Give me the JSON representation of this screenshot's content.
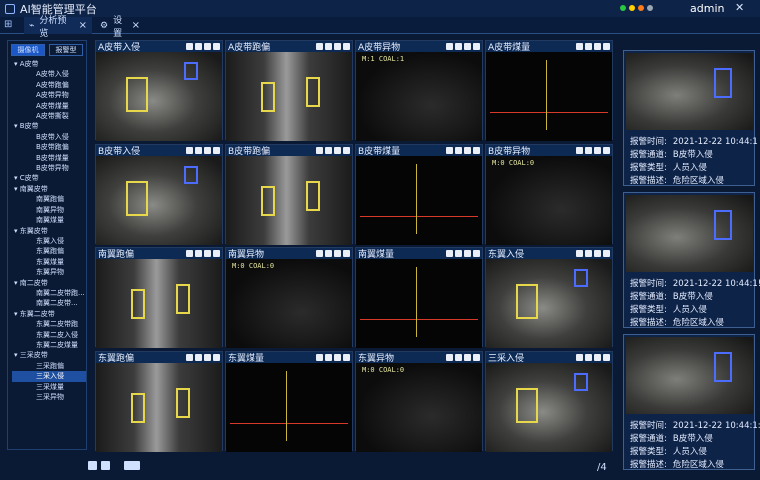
{
  "app": {
    "title": "AI智能管理平台",
    "user": "admin",
    "dots": [
      "#28c840",
      "#ffd100",
      "#ff7a1a",
      "#9aa6b2"
    ]
  },
  "tabs": [
    {
      "label": "分析预览",
      "close": "×"
    },
    {
      "label": "设置",
      "close": "×"
    }
  ],
  "sidebar": {
    "tabs": [
      "摄像机",
      "报警型"
    ],
    "tree": [
      {
        "label": "A皮带",
        "level": 0,
        "sel": false
      },
      {
        "label": "A皮带入侵",
        "level": 1,
        "sel": false
      },
      {
        "label": "A皮带跑偏",
        "level": 1,
        "sel": false
      },
      {
        "label": "A皮带异物",
        "level": 1,
        "sel": false
      },
      {
        "label": "A皮带煤量",
        "level": 1,
        "sel": false
      },
      {
        "label": "A皮带撕裂",
        "level": 1,
        "sel": false
      },
      {
        "label": "B皮带",
        "level": 0,
        "sel": false
      },
      {
        "label": "B皮带入侵",
        "level": 1,
        "sel": false
      },
      {
        "label": "B皮带跑偏",
        "level": 1,
        "sel": false
      },
      {
        "label": "B皮带煤量",
        "level": 1,
        "sel": false
      },
      {
        "label": "B皮带异物",
        "level": 1,
        "sel": false
      },
      {
        "label": "C皮带",
        "level": 0,
        "sel": false
      },
      {
        "label": "南翼皮带",
        "level": 0,
        "sel": false
      },
      {
        "label": "南翼跑偏",
        "level": 1,
        "sel": false
      },
      {
        "label": "南翼异物",
        "level": 1,
        "sel": false
      },
      {
        "label": "南翼煤量",
        "level": 1,
        "sel": false
      },
      {
        "label": "东翼皮带",
        "level": 0,
        "sel": false
      },
      {
        "label": "东翼入侵",
        "level": 1,
        "sel": false
      },
      {
        "label": "东翼跑偏",
        "level": 1,
        "sel": false
      },
      {
        "label": "东翼煤量",
        "level": 1,
        "sel": false
      },
      {
        "label": "东翼异物",
        "level": 1,
        "sel": false
      },
      {
        "label": "南二皮带",
        "level": 0,
        "sel": false
      },
      {
        "label": "南翼二皮带跑...",
        "level": 1,
        "sel": false
      },
      {
        "label": "南翼二皮带...",
        "level": 1,
        "sel": false
      },
      {
        "label": "东翼二皮带",
        "level": 0,
        "sel": false
      },
      {
        "label": "东翼二皮带跑",
        "level": 1,
        "sel": false
      },
      {
        "label": "东翼二皮入侵",
        "level": 1,
        "sel": false
      },
      {
        "label": "东翼二皮煤量",
        "level": 1,
        "sel": false
      },
      {
        "label": "三采皮带",
        "level": 0,
        "sel": false
      },
      {
        "label": "三采跑偏",
        "level": 1,
        "sel": false
      },
      {
        "label": "三采入侵",
        "level": 1,
        "sel": true
      },
      {
        "label": "三采煤量",
        "level": 1,
        "sel": false
      },
      {
        "label": "三采异物",
        "level": 1,
        "sel": false
      }
    ]
  },
  "cells": [
    {
      "title": "A皮带入侵",
      "kind": "mine",
      "overlay": ""
    },
    {
      "title": "A皮带跑偏",
      "kind": "belt",
      "overlay": ""
    },
    {
      "title": "A皮带异物",
      "kind": "dark",
      "overlay": "M:1 COAL:1"
    },
    {
      "title": "A皮带煤量",
      "kind": "graph",
      "overlay": ""
    },
    {
      "title": "B皮带入侵",
      "kind": "mine",
      "overlay": ""
    },
    {
      "title": "B皮带跑偏",
      "kind": "belt",
      "overlay": ""
    },
    {
      "title": "B皮带煤量",
      "kind": "graph",
      "overlay": ""
    },
    {
      "title": "B皮带异物",
      "kind": "dark",
      "overlay": "M:0 COAL:0"
    },
    {
      "title": "南翼跑偏",
      "kind": "belt",
      "overlay": ""
    },
    {
      "title": "南翼异物",
      "kind": "dark",
      "overlay": "M:0 COAL:0"
    },
    {
      "title": "南翼煤量",
      "kind": "graph",
      "overlay": ""
    },
    {
      "title": "东翼入侵",
      "kind": "mine",
      "overlay": ""
    },
    {
      "title": "东翼跑偏",
      "kind": "belt",
      "overlay": ""
    },
    {
      "title": "东翼煤量",
      "kind": "graph",
      "overlay": ""
    },
    {
      "title": "东翼异物",
      "kind": "dark",
      "overlay": "M:0 COAL:0"
    },
    {
      "title": "三采入侵",
      "kind": "mine",
      "overlay": ""
    }
  ],
  "alarms": [
    {
      "time_label": "报警时间:",
      "time": "2021-12-22 10:44:1",
      "chan_label": "报警通道:",
      "chan": "B皮带入侵",
      "type_label": "报警类型:",
      "type": "人员入侵",
      "desc_label": "报警描述:",
      "desc": "危险区域入侵"
    },
    {
      "time_label": "报警时间:",
      "time": "2021-12-22 10:44:1!",
      "chan_label": "报警通道:",
      "chan": "B皮带入侵",
      "type_label": "报警类型:",
      "type": "人员入侵",
      "desc_label": "报警描述:",
      "desc": "危险区域入侵"
    },
    {
      "time_label": "报警时间:",
      "time": "2021-12-22 10:44:1:",
      "chan_label": "报警通道:",
      "chan": "B皮带入侵",
      "type_label": "报警类型:",
      "type": "人员入侵",
      "desc_label": "报警描述:",
      "desc": "危险区域入侵"
    }
  ],
  "footer": {
    "page": "/4"
  }
}
